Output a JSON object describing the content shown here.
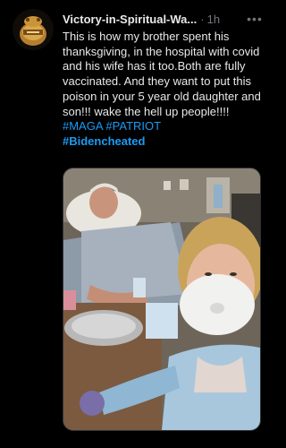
{
  "tweet": {
    "author": "Victory-in-Spiritual-Wa...",
    "separator": "·",
    "time": "1h",
    "more_label": "•••",
    "text_parts": {
      "p1": "This is how my brother spent his thanksgiving, in the hospital with covid and his wife has it too.Both are fully vaccinated. And they want to put this poison in your 5 year old daughter and son!!! wake the hell up people!!!! ",
      "tag_maga": "#MAGA",
      "tag_patriot": "#PATRIOT",
      "tag_bidencheated": "#Bidencheated"
    }
  },
  "colors": {
    "background": "#000000",
    "text": "#e7e9ea",
    "secondary": "#71767b",
    "hashtag": "#1d9bf0"
  },
  "icons": {
    "more": "more-dots-icon",
    "avatar": "profile-avatar"
  }
}
